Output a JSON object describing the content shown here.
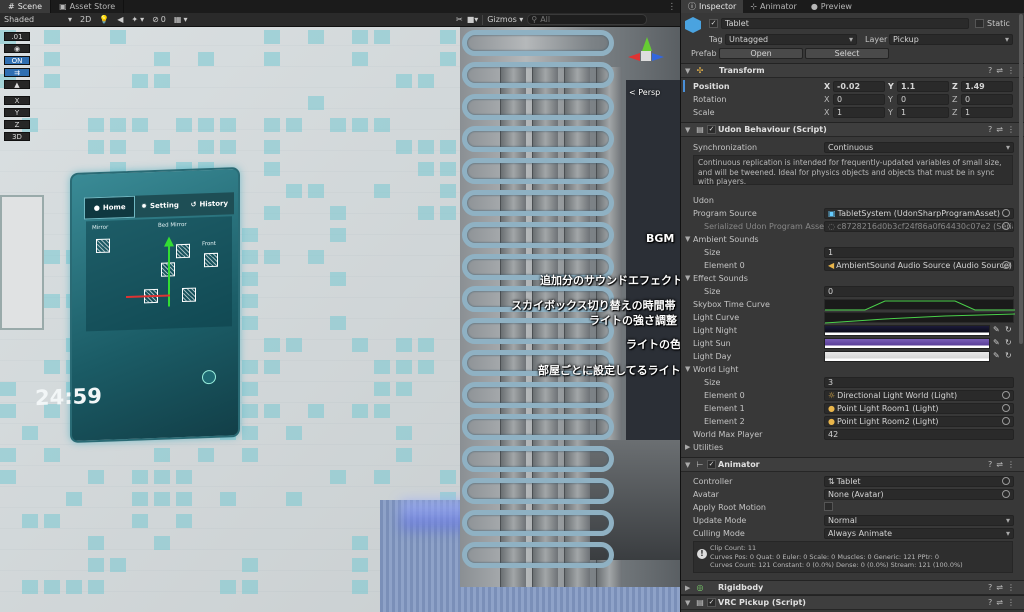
{
  "scene": {
    "tabs": [
      {
        "label": "Scene",
        "icon": "scene-icon"
      },
      {
        "label": "Asset Store",
        "icon": "store-icon"
      }
    ],
    "toolbar": {
      "shading": "Shaded",
      "mode2d": "2D",
      "gizmos": "Gizmos",
      "search_placeholder": "All",
      "hidden_count": "0"
    },
    "overlay_buttons": [
      ".01",
      "",
      "ON",
      "",
      "",
      "X",
      "Y",
      "Z",
      "3D"
    ],
    "persp_label": "< Persp",
    "tablet": {
      "tabs": [
        "Home",
        "Setting",
        "History"
      ],
      "mirror_label": "Mirror",
      "bed_mirror_label": "Bed Mirror",
      "front_label": "Front",
      "time": "24:59"
    },
    "annotations": [
      "BGM",
      "追加分のサウンドエフェクト",
      "スカイボックス切り替えの時間帯",
      "ライトの強さ調整",
      "ライトの色",
      "部屋ごとに設定してるライト"
    ]
  },
  "inspector": {
    "tabs": [
      "Inspector",
      "Animator",
      "Preview"
    ],
    "object": {
      "name": "Tablet",
      "static_label": "Static",
      "tag_label": "Tag",
      "tag_value": "Untagged",
      "layer_label": "Layer",
      "layer_value": "Pickup",
      "prefab_label": "Prefab",
      "open_label": "Open",
      "select_label": "Select"
    },
    "transform": {
      "title": "Transform",
      "position_label": "Position",
      "rotation_label": "Rotation",
      "scale_label": "Scale",
      "position": [
        "-0.02",
        "1.1",
        "1.49"
      ],
      "rotation": [
        "0",
        "0",
        "0"
      ],
      "scale": [
        "1",
        "1",
        "1"
      ]
    },
    "udon": {
      "title": "Udon Behaviour (Script)",
      "sync_label": "Synchronization",
      "sync_value": "Continuous",
      "help": "Continuous replication is intended for frequently-updated variables of small size, and will be tweened. Ideal for physics objects and objects that must be in sync with players.",
      "udon_label": "Udon",
      "program_source_label": "Program Source",
      "program_source_value": "TabletSystem (UdonSharpProgramAsset)",
      "serialized_label": "Serialized Udon Program Asset I",
      "serialized_value": "c8728216d0b3cf24f86a0f64430c07e2 (Seria",
      "ambient_label": "Ambient Sounds",
      "size_label": "Size",
      "ambient_size": "1",
      "element0_label": "Element 0",
      "ambient_el0": "AmbientSound Audio Source (Audio Source)",
      "effect_label": "Effect Sounds",
      "effect_size": "0",
      "skybox_label": "Skybox Time Curve",
      "light_curve_label": "Light Curve",
      "light_night_label": "Light Night",
      "light_sun_label": "Light Sun",
      "light_day_label": "Light Day",
      "world_light_label": "World Light",
      "world_size": "3",
      "element1_label": "Element 1",
      "element2_label": "Element 2",
      "world_el0": "Directional Light World (Light)",
      "world_el1": "Point Light Room1 (Light)",
      "world_el2": "Point Light Room2 (Light)",
      "max_player_label": "World Max Player",
      "max_player": "42",
      "utilities_label": "Utilities"
    },
    "animator": {
      "title": "Animator",
      "controller_label": "Controller",
      "controller_value": "Tablet",
      "avatar_label": "Avatar",
      "avatar_value": "None (Avatar)",
      "root_motion_label": "Apply Root Motion",
      "update_mode_label": "Update Mode",
      "update_mode_value": "Normal",
      "culling_label": "Culling Mode",
      "culling_value": "Always Animate",
      "info": [
        "Clip Count: 11",
        "Curves Pos: 0 Quat: 0 Euler: 0 Scale: 0 Muscles: 0 Generic: 121 PPtr: 0",
        "Curves Count: 121 Constant: 0 (0.0%) Dense: 0 (0.0%) Stream: 121 (100.0%)"
      ]
    },
    "rigidbody_title": "Rigidbody",
    "pickup_title": "VRC Pickup (Script)"
  }
}
